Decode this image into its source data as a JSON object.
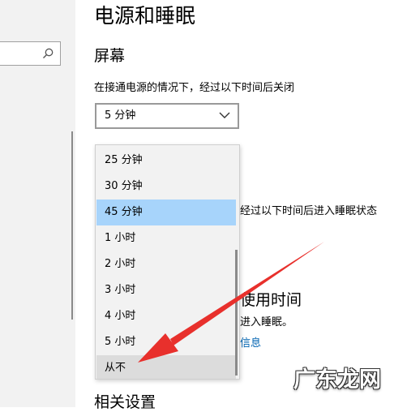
{
  "header": {
    "title": "电源和睡眠"
  },
  "screen_section": {
    "title": "屏幕",
    "plugged_in_description": "在接通电源的情况下，经过以下时间后关闭",
    "selected_value": "5 分钟"
  },
  "dropdown": {
    "options": [
      {
        "label": "25 分钟",
        "state": "normal"
      },
      {
        "label": "30 分钟",
        "state": "normal"
      },
      {
        "label": "45 分钟",
        "state": "selected"
      },
      {
        "label": "1 小时",
        "state": "normal"
      },
      {
        "label": "2 小时",
        "state": "normal"
      },
      {
        "label": "3 小时",
        "state": "normal"
      },
      {
        "label": "4 小时",
        "state": "normal"
      },
      {
        "label": "5 小时",
        "state": "normal"
      },
      {
        "label": "从不",
        "state": "hovered"
      }
    ]
  },
  "partially_hidden": {
    "sleep_description": "经过以下时间后进入睡眠状态",
    "usage_title": "使用时间",
    "usage_description": "进入睡眠。",
    "usage_link": "信息"
  },
  "related": {
    "title": "相关设置"
  },
  "watermark": {
    "text": "广东龙网"
  },
  "colors": {
    "accent": "#0063b1",
    "selected_option": "#a7d4fb",
    "hovered_option": "#dcdcdc",
    "annotation_arrow": "#e8302c"
  },
  "icons": {
    "search": "search-icon",
    "chevron": "chevron-down-icon"
  }
}
